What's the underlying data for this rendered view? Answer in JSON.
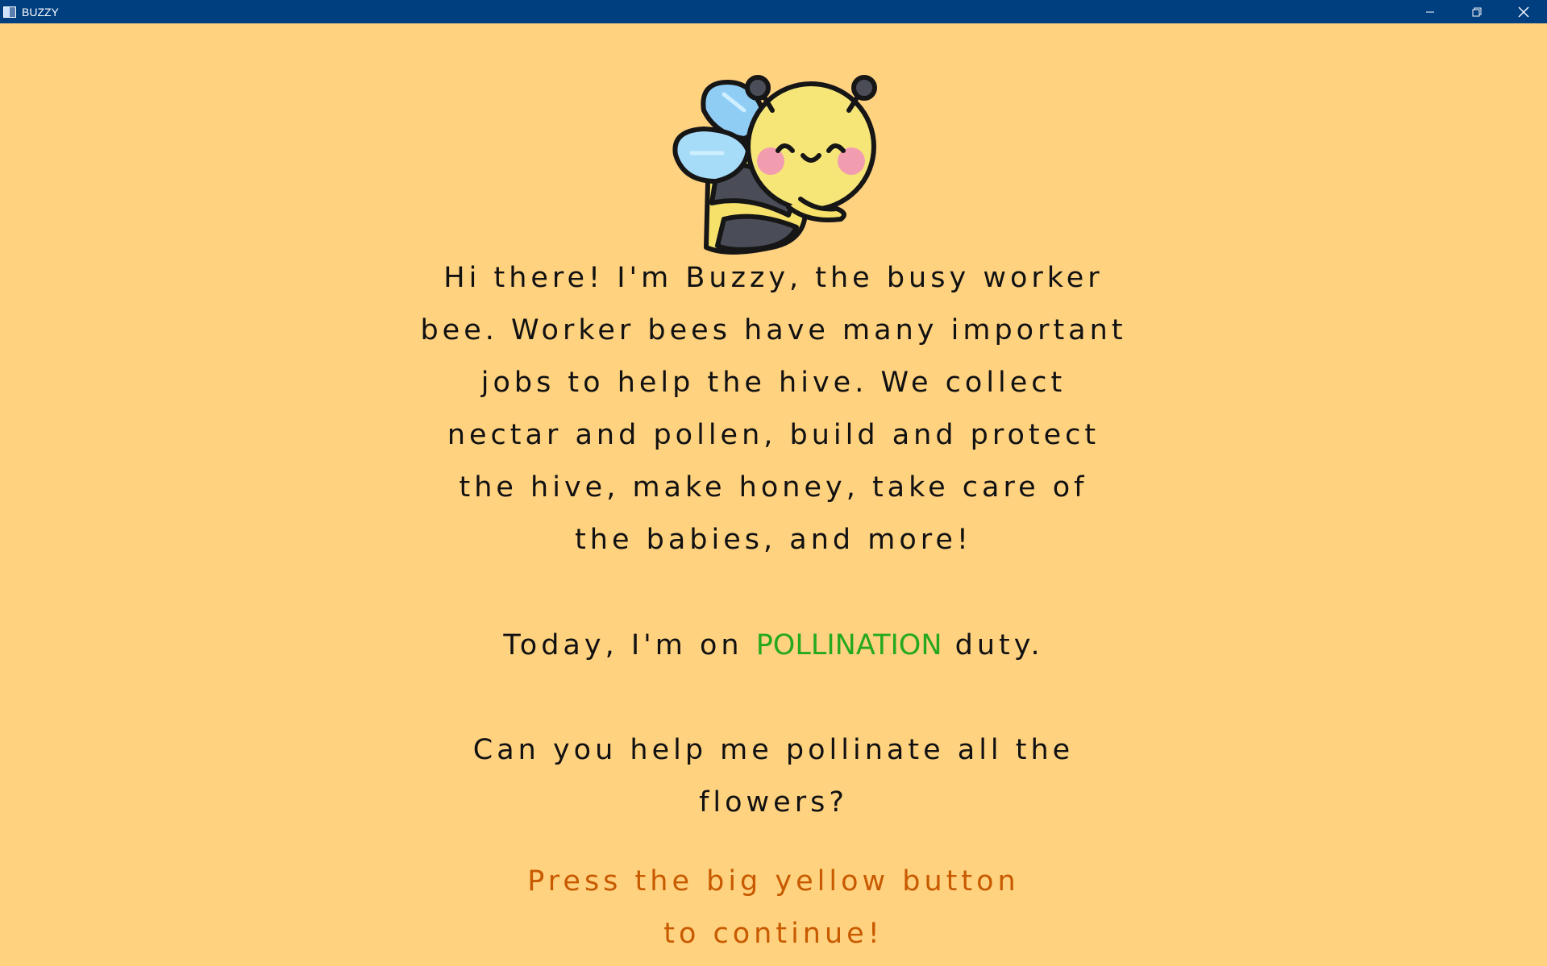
{
  "window": {
    "title": "BUZZY"
  },
  "intro": {
    "lines": [
      "Hi there! I'm Buzzy, the busy worker",
      "bee. Worker bees have many important",
      "jobs to help the hive. We collect",
      "nectar and pollen, build and protect",
      "the hive, make honey, take care of",
      "the babies, and more!"
    ]
  },
  "duty": {
    "prefix": "Today, I'm on ",
    "highlight": "POLLINATION",
    "suffix": " duty."
  },
  "question": {
    "lines": [
      "Can you help me pollinate all the",
      "flowers?"
    ]
  },
  "instruction": {
    "lines": [
      "Press the big yellow button",
      "to continue!"
    ]
  },
  "colors": {
    "background": "#ffd280",
    "titlebar": "#003f7f",
    "text": "#111111",
    "highlight": "#26a81f",
    "instruction": "#c85a00"
  },
  "icons": {
    "app": "app-icon",
    "mascot": "bee-mascot-icon",
    "minimize": "minimize-icon",
    "restore": "restore-icon",
    "close": "close-icon"
  }
}
